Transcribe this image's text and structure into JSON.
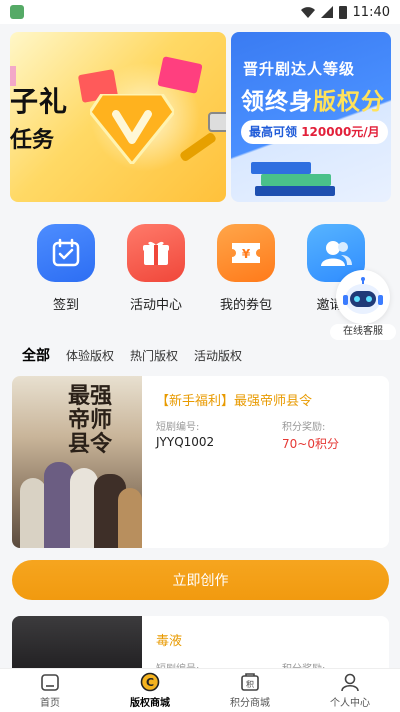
{
  "status_bar": {
    "time": "11:40"
  },
  "banners": {
    "left": {
      "text_big": "子礼",
      "text_small": "任务"
    },
    "right": {
      "line1": "晋升剧达人等级",
      "line2_prefix": "领终身",
      "line2_highlight": "版权分",
      "line3_prefix": "最高可领",
      "line3_amount": "120000元/月"
    }
  },
  "quick_menu": [
    {
      "label": "签到",
      "icon": "calendar-check-icon"
    },
    {
      "label": "活动中心",
      "icon": "gift-icon"
    },
    {
      "label": "我的券包",
      "icon": "coupon-icon"
    },
    {
      "label": "邀请好",
      "icon": "users-icon"
    }
  ],
  "floating_service": {
    "label": "在线客服"
  },
  "tabs": [
    "全部",
    "体验版权",
    "热门版权",
    "活动版权"
  ],
  "cards": [
    {
      "title": "【新手福利】最强帝师县令",
      "code_label": "短剧编号:",
      "code_value": "JYYQ1002",
      "points_label": "积分奖励:",
      "points_value": "70~0积分",
      "poster_text": "最强帝师县令"
    },
    {
      "title": "毒液",
      "code_label": "短剧编号:",
      "points_label": "积分奖励:"
    }
  ],
  "create_button": "立即创作",
  "bottom_nav": [
    {
      "label": "首页",
      "icon": "home-icon"
    },
    {
      "label": "版权商城",
      "icon": "copyright-icon"
    },
    {
      "label": "积分商城",
      "icon": "points-shop-icon"
    },
    {
      "label": "个人中心",
      "icon": "user-icon"
    }
  ],
  "colors": {
    "accent_orange": "#f19a0f",
    "title_orange": "#e89a00",
    "points_red": "#e53935",
    "banner_blue": "#3a7bf2"
  }
}
